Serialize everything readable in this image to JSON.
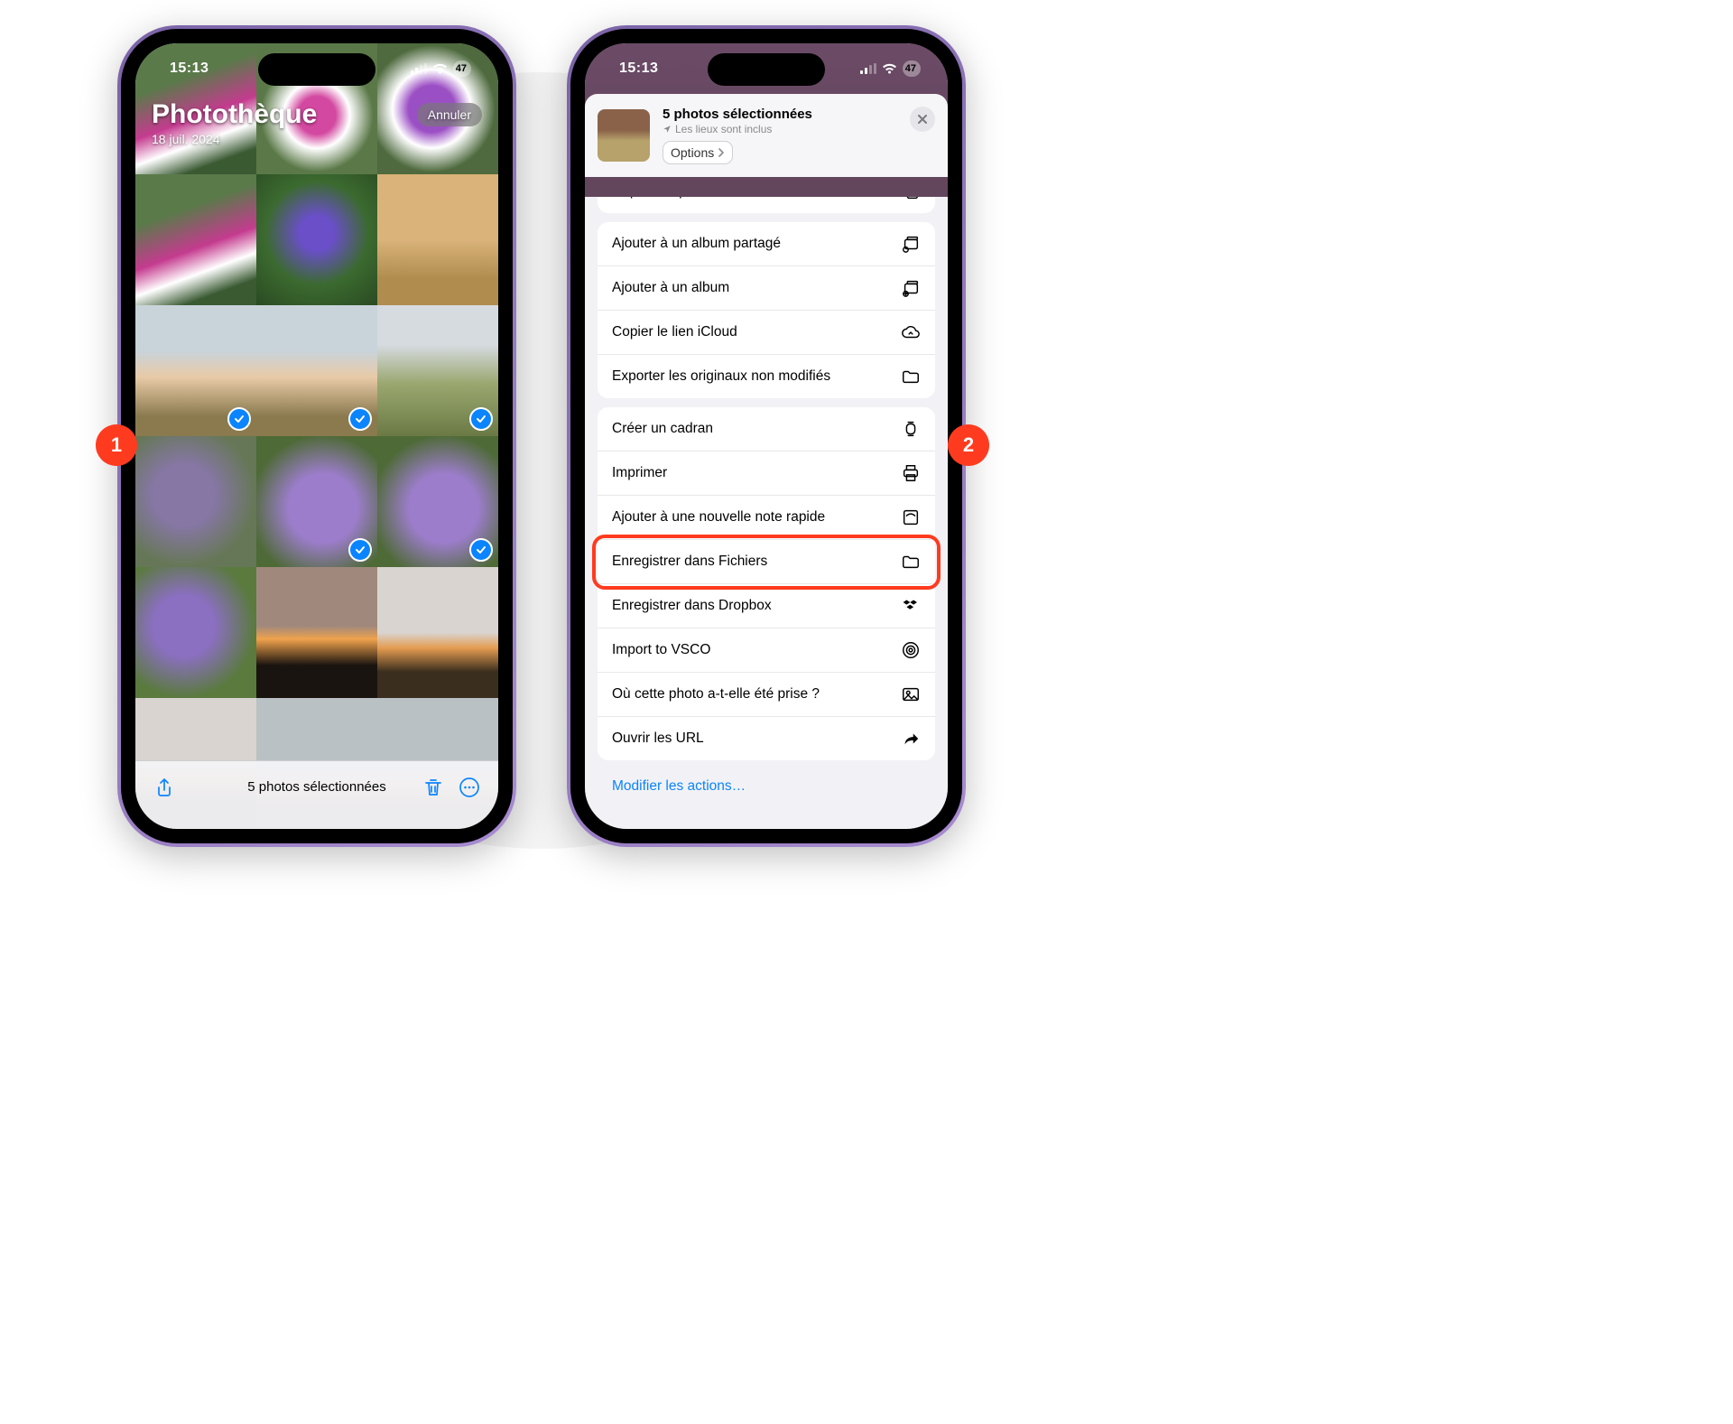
{
  "status": {
    "time": "15:13",
    "battery": "47"
  },
  "phone1": {
    "title": "Photothèque",
    "date": "18 juil. 2024",
    "cancel": "Annuler",
    "selection_summary": "5 photos sélectionnées",
    "thumbnails": [
      {
        "name": "fuchsia-1",
        "class": "t-fuchsia",
        "selected": false
      },
      {
        "name": "fuchsia-2",
        "class": "t-fuchsia2",
        "selected": false
      },
      {
        "name": "fuchsia-3",
        "class": "t-fuchsia3",
        "selected": false
      },
      {
        "name": "fuchsia-4",
        "class": "t-fuchsia",
        "selected": false
      },
      {
        "name": "orchid",
        "class": "t-orchid",
        "selected": false
      },
      {
        "name": "wheat",
        "class": "t-wheat",
        "selected": false
      },
      {
        "name": "field-sunset-1",
        "class": "t-field-sunset",
        "selected": true
      },
      {
        "name": "field-sunset-2",
        "class": "t-field-sunset",
        "selected": true
      },
      {
        "name": "field-grass",
        "class": "t-field-grass",
        "selected": true
      },
      {
        "name": "purple-flowers-1",
        "class": "t-purple-flowers faded",
        "selected": false
      },
      {
        "name": "purple-flowers-2",
        "class": "t-purple-dense",
        "selected": true
      },
      {
        "name": "purple-flowers-3",
        "class": "t-purple-dense",
        "selected": true
      },
      {
        "name": "purple-flowers-4",
        "class": "t-purple-flowers",
        "selected": false
      },
      {
        "name": "sunset-dark",
        "class": "t-sunset-dark",
        "selected": false
      },
      {
        "name": "sunset-wide-1",
        "class": "t-sunset-wide",
        "selected": false
      },
      {
        "name": "sunset-wide-2",
        "class": "t-sunset-wide",
        "selected": false
      },
      {
        "name": "sunset-dim-1",
        "class": "t-sunset-dim",
        "selected": false
      },
      {
        "name": "sunset-dim-2",
        "class": "t-sunset-dim",
        "selected": false
      }
    ]
  },
  "phone2": {
    "header": {
      "title": "5 photos sélectionnées",
      "subtitle": "Les lieux sont inclus",
      "options": "Options"
    },
    "groups": [
      {
        "rows": [
          {
            "label": "Copier les photos",
            "icon": "copy"
          }
        ]
      },
      {
        "rows": [
          {
            "label": "Ajouter à un album partagé",
            "icon": "album-shared"
          },
          {
            "label": "Ajouter à un album",
            "icon": "album-add"
          },
          {
            "label": "Copier le lien iCloud",
            "icon": "cloud"
          },
          {
            "label": "Exporter les originaux non modifiés",
            "icon": "folder"
          }
        ]
      },
      {
        "rows": [
          {
            "label": "Créer un cadran",
            "icon": "watch"
          },
          {
            "label": "Imprimer",
            "icon": "print"
          },
          {
            "label": "Ajouter à une nouvelle note rapide",
            "icon": "quicknote"
          },
          {
            "label": "Enregistrer dans Fichiers",
            "icon": "folder",
            "highlight": true
          },
          {
            "label": "Enregistrer dans Dropbox",
            "icon": "dropbox"
          },
          {
            "label": "Import to VSCO",
            "icon": "vsco"
          },
          {
            "label": "Où cette photo a-t-elle été prise ?",
            "icon": "image"
          },
          {
            "label": "Ouvrir les URL",
            "icon": "share-arrow"
          }
        ]
      }
    ],
    "edit_actions": "Modifier les actions…"
  },
  "callouts": {
    "one": "1",
    "two": "2"
  }
}
